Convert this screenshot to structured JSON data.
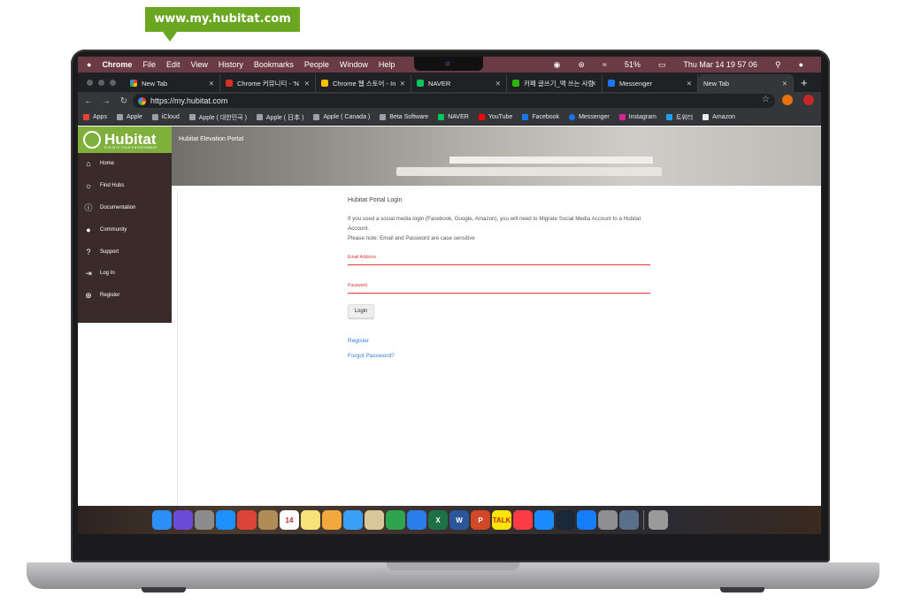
{
  "callout": {
    "text": "www.my.hubitat.com"
  },
  "menubar": {
    "apple_icon": "apple-icon",
    "app": "Chrome",
    "items": [
      "File",
      "Edit",
      "View",
      "History",
      "Bookmarks",
      "People",
      "Window",
      "Help"
    ],
    "battery": "51%",
    "clock": "Thu Mar 14  19 57 06"
  },
  "tabs": [
    {
      "title": "New Tab",
      "color": "#4285f4",
      "active": false
    },
    {
      "title": "Chrome 커뮤니티 - 'N",
      "color": "#d93025",
      "active": false
    },
    {
      "title": "Chrome 웹 스토어 - In",
      "color": "#fbbc05",
      "active": false
    },
    {
      "title": "NAVER",
      "color": "#03c75a",
      "active": false
    },
    {
      "title": "카페 글쓰기_맥 쓰는 사람",
      "color": "#2db400",
      "active": false
    },
    {
      "title": "Messenger",
      "color": "#1877f2",
      "active": false
    },
    {
      "title": "New Tab",
      "color": "#35363a",
      "active": true
    }
  ],
  "address": {
    "url": "https://my.hubitat.com"
  },
  "bookmarks": [
    {
      "label": "Apps",
      "color": "#ea4335"
    },
    {
      "label": "Apple",
      "color": "#9aa0a6"
    },
    {
      "label": "iCloud",
      "color": "#9aa0a6"
    },
    {
      "label": "Apple ( 대한민국 )",
      "color": "#9aa0a6"
    },
    {
      "label": "Apple ( 日本 )",
      "color": "#9aa0a6"
    },
    {
      "label": "Apple ( Canada )",
      "color": "#9aa0a6"
    },
    {
      "label": "Beta Software",
      "color": "#9aa0a6"
    },
    {
      "label": "NAVER",
      "color": "#03c75a"
    },
    {
      "label": "YouTube",
      "color": "#ff0000"
    },
    {
      "label": "Facebook",
      "color": "#1877f2"
    },
    {
      "label": "Messenger",
      "color": "#1877f2"
    },
    {
      "label": "Instagram",
      "color": "#d6249f"
    },
    {
      "label": "트위터",
      "color": "#1da1f2"
    },
    {
      "label": "Amazon",
      "color": "#e8eaed"
    }
  ],
  "site": {
    "brand": "Hubitat",
    "brand_tagline": "ELEVATE YOUR ENVIRONMENT",
    "portal_title": "Hubitat Elevation Portal",
    "nav": [
      {
        "label": "Home",
        "icon": "home-icon"
      },
      {
        "label": "Find Hubs",
        "icon": "lightbulb-icon"
      },
      {
        "label": "Documentation",
        "icon": "info-icon"
      },
      {
        "label": "Community",
        "icon": "people-icon"
      },
      {
        "label": "Support",
        "icon": "question-icon"
      },
      {
        "label": "Log In",
        "icon": "login-icon"
      },
      {
        "label": "Register",
        "icon": "plus-circle-icon"
      }
    ],
    "login": {
      "heading": "Hubitat Portal Login",
      "notice_1": "If you used a social media login (Facebook, Google, Amazon), you will need to Migrate Social Media Account to a Hubitat Account.",
      "notice_2": "Please note: Email and Password are case sensitive",
      "email_label": "Email Address",
      "password_label": "Password",
      "button": "Login",
      "register_link": "Register",
      "forgot_link": "Forgot Password?"
    }
  },
  "dock": [
    {
      "name": "finder-icon",
      "color": "#2c8ef8"
    },
    {
      "name": "siri-icon",
      "color": "#6b4cd6"
    },
    {
      "name": "launchpad-icon",
      "color": "#8c8c8c"
    },
    {
      "name": "safari-icon",
      "color": "#1e90ff"
    },
    {
      "name": "chrome-icon",
      "color": "#db4437"
    },
    {
      "name": "notes-brown-icon",
      "color": "#b08d57"
    },
    {
      "name": "calendar-icon",
      "color": "#ffffff",
      "text": "14"
    },
    {
      "name": "notes-icon",
      "color": "#f7e27a"
    },
    {
      "name": "photos-icon",
      "color": "#f2a93b"
    },
    {
      "name": "messages-icon",
      "color": "#39a0f5"
    },
    {
      "name": "preview-icon",
      "color": "#d9c79a"
    },
    {
      "name": "numbers-icon",
      "color": "#2ea44f"
    },
    {
      "name": "keynote-icon",
      "color": "#2b7de9"
    },
    {
      "name": "excel-icon",
      "color": "#1e7145",
      "text": "X"
    },
    {
      "name": "word-icon",
      "color": "#2b579a",
      "text": "W"
    },
    {
      "name": "powerpoint-icon",
      "color": "#d24726",
      "text": "P"
    },
    {
      "name": "kakaotalk-icon",
      "color": "#fee500",
      "text": "TALK"
    },
    {
      "name": "music-icon",
      "color": "#fc3c44"
    },
    {
      "name": "appstore-icon",
      "color": "#1a8cff"
    },
    {
      "name": "steam-icon",
      "color": "#1b2838"
    },
    {
      "name": "xcode-icon",
      "color": "#147efb"
    },
    {
      "name": "system-preferences-icon",
      "color": "#8e8e93"
    },
    {
      "name": "remote-desktop-icon",
      "color": "#5a6f8a"
    },
    {
      "name": "trash-icon",
      "color": "#9a9a9a"
    }
  ]
}
